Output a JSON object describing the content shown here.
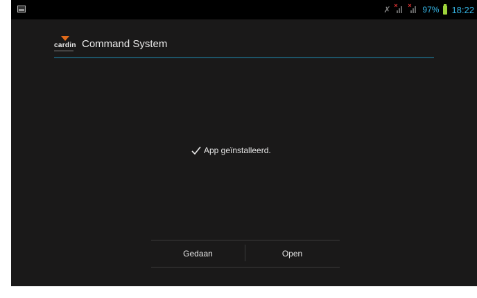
{
  "status_bar": {
    "battery_percent": "97%",
    "time": "18:22",
    "icons": [
      "gallery-icon",
      "mute-icon",
      "no-signal-icon",
      "no-signal-icon",
      "battery-icon"
    ]
  },
  "app": {
    "logo_text": "cardin",
    "title": "Command System"
  },
  "dialog": {
    "message": "App geïnstalleerd.",
    "buttons": {
      "done": "Gedaan",
      "open": "Open"
    }
  },
  "colors": {
    "background": "#1a1919",
    "accent_divider": "#1d5468",
    "status_accent": "#35b5e5",
    "battery": "#9dd23a",
    "logo_orange": "#e06a1a"
  }
}
